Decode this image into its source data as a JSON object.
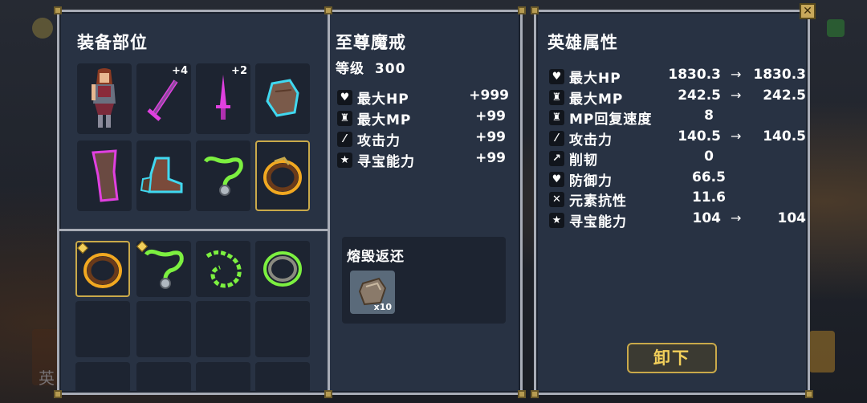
{
  "equip_panel": {
    "title": "装备部位",
    "equipped_slots": [
      {
        "item": "hero-portrait",
        "plus": ""
      },
      {
        "item": "magenta-sword",
        "plus": "+4"
      },
      {
        "item": "magenta-dagger",
        "plus": "+2"
      },
      {
        "item": "cyan-gloves",
        "plus": ""
      },
      {
        "item": "magenta-leggings",
        "plus": ""
      },
      {
        "item": "cyan-boots",
        "plus": ""
      },
      {
        "item": "green-necklace",
        "plus": ""
      },
      {
        "item": "gold-ring",
        "plus": ""
      }
    ],
    "inventory_slots": [
      {
        "item": "gold-ring",
        "new": true
      },
      {
        "item": "green-necklace",
        "new": true
      },
      {
        "item": "green-chain",
        "new": false
      },
      {
        "item": "green-ring",
        "new": false
      }
    ]
  },
  "item_detail": {
    "name": "至尊魔戒",
    "level_label": "等级",
    "level": "300",
    "stats": [
      {
        "icon": "heart-icon",
        "name": "最大HP",
        "value": "+999"
      },
      {
        "icon": "potion-icon",
        "name": "最大MP",
        "value": "+99"
      },
      {
        "icon": "sword-icon",
        "name": "攻击力",
        "value": "+99"
      },
      {
        "icon": "star-icon",
        "name": "寻宝能力",
        "value": "+99"
      }
    ],
    "smelt_title": "熔毁返还",
    "smelt_reward_count": "x10"
  },
  "hero_panel": {
    "title": "英雄属性",
    "stats": [
      {
        "icon": "heart-icon",
        "name": "最大HP",
        "current": "1830.3",
        "arrow": "→",
        "next": "1830.3"
      },
      {
        "icon": "potion-icon",
        "name": "最大MP",
        "current": "242.5",
        "arrow": "→",
        "next": "242.5"
      },
      {
        "icon": "potion-icon",
        "name": "MP回复速度",
        "current": "8",
        "arrow": "",
        "next": ""
      },
      {
        "icon": "sword-icon",
        "name": "攻击力",
        "current": "140.5",
        "arrow": "→",
        "next": "140.5"
      },
      {
        "icon": "axe-icon",
        "name": "削韧",
        "current": "0",
        "arrow": "",
        "next": ""
      },
      {
        "icon": "shield-icon",
        "name": "防御力",
        "current": "66.5",
        "arrow": "",
        "next": ""
      },
      {
        "icon": "cross-swords-icon",
        "name": "元素抗性",
        "current": "11.6",
        "arrow": "",
        "next": ""
      },
      {
        "icon": "star-icon",
        "name": "寻宝能力",
        "current": "104",
        "arrow": "→",
        "next": "104"
      }
    ],
    "unequip_label": "卸下",
    "close_label": "✕"
  },
  "background": {
    "text": "英"
  },
  "colors": {
    "panel": "#283243",
    "border": "#a8acb6",
    "slot": "#1d2431",
    "gold": "#c9a94a",
    "magenta": "#e040e0",
    "cyan": "#40d8f0",
    "green": "#7cf040"
  }
}
